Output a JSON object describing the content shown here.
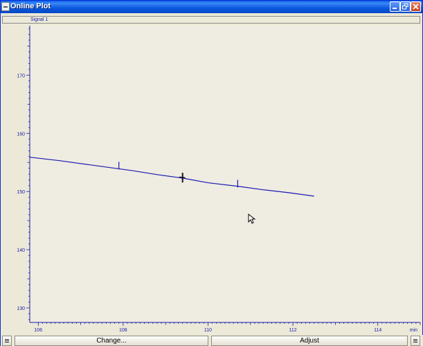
{
  "window": {
    "title": "Online Plot",
    "buttons": [
      "minimize",
      "restore",
      "close"
    ]
  },
  "signal_bar": {
    "label": "Signal 1"
  },
  "chart_data": {
    "type": "line",
    "title": "",
    "xlabel": "min",
    "ylabel": "",
    "xlim": [
      105.8,
      115.0
    ],
    "ylim": [
      127.5,
      178.5
    ],
    "x_ticks": [
      106,
      108,
      110,
      112,
      114
    ],
    "y_ticks": [
      130,
      140,
      150,
      160,
      170
    ],
    "grid": false,
    "series": [
      {
        "color": "#1a1ab0",
        "x": [
          105.8,
          106.5,
          107.2,
          107.9,
          108.2,
          108.8,
          109.4,
          110.0,
          110.7,
          111.3,
          111.9,
          112.5
        ],
        "y": [
          155.9,
          155.3,
          154.6,
          153.9,
          153.6,
          152.9,
          152.3,
          151.5,
          150.9,
          150.3,
          149.8,
          149.2
        ]
      }
    ],
    "spikes": [
      {
        "x": 107.9,
        "y": 155.1
      },
      {
        "x": 110.7,
        "y": 152.0
      }
    ],
    "marker": {
      "x": 109.4,
      "y": 152.5
    }
  },
  "bottom_bar": {
    "change_label": "Change...",
    "adjust_label": "Adjust"
  },
  "colors": {
    "axis": "#1a1aa8",
    "trace": "#1a1ab0",
    "background": "#ece9d8"
  }
}
